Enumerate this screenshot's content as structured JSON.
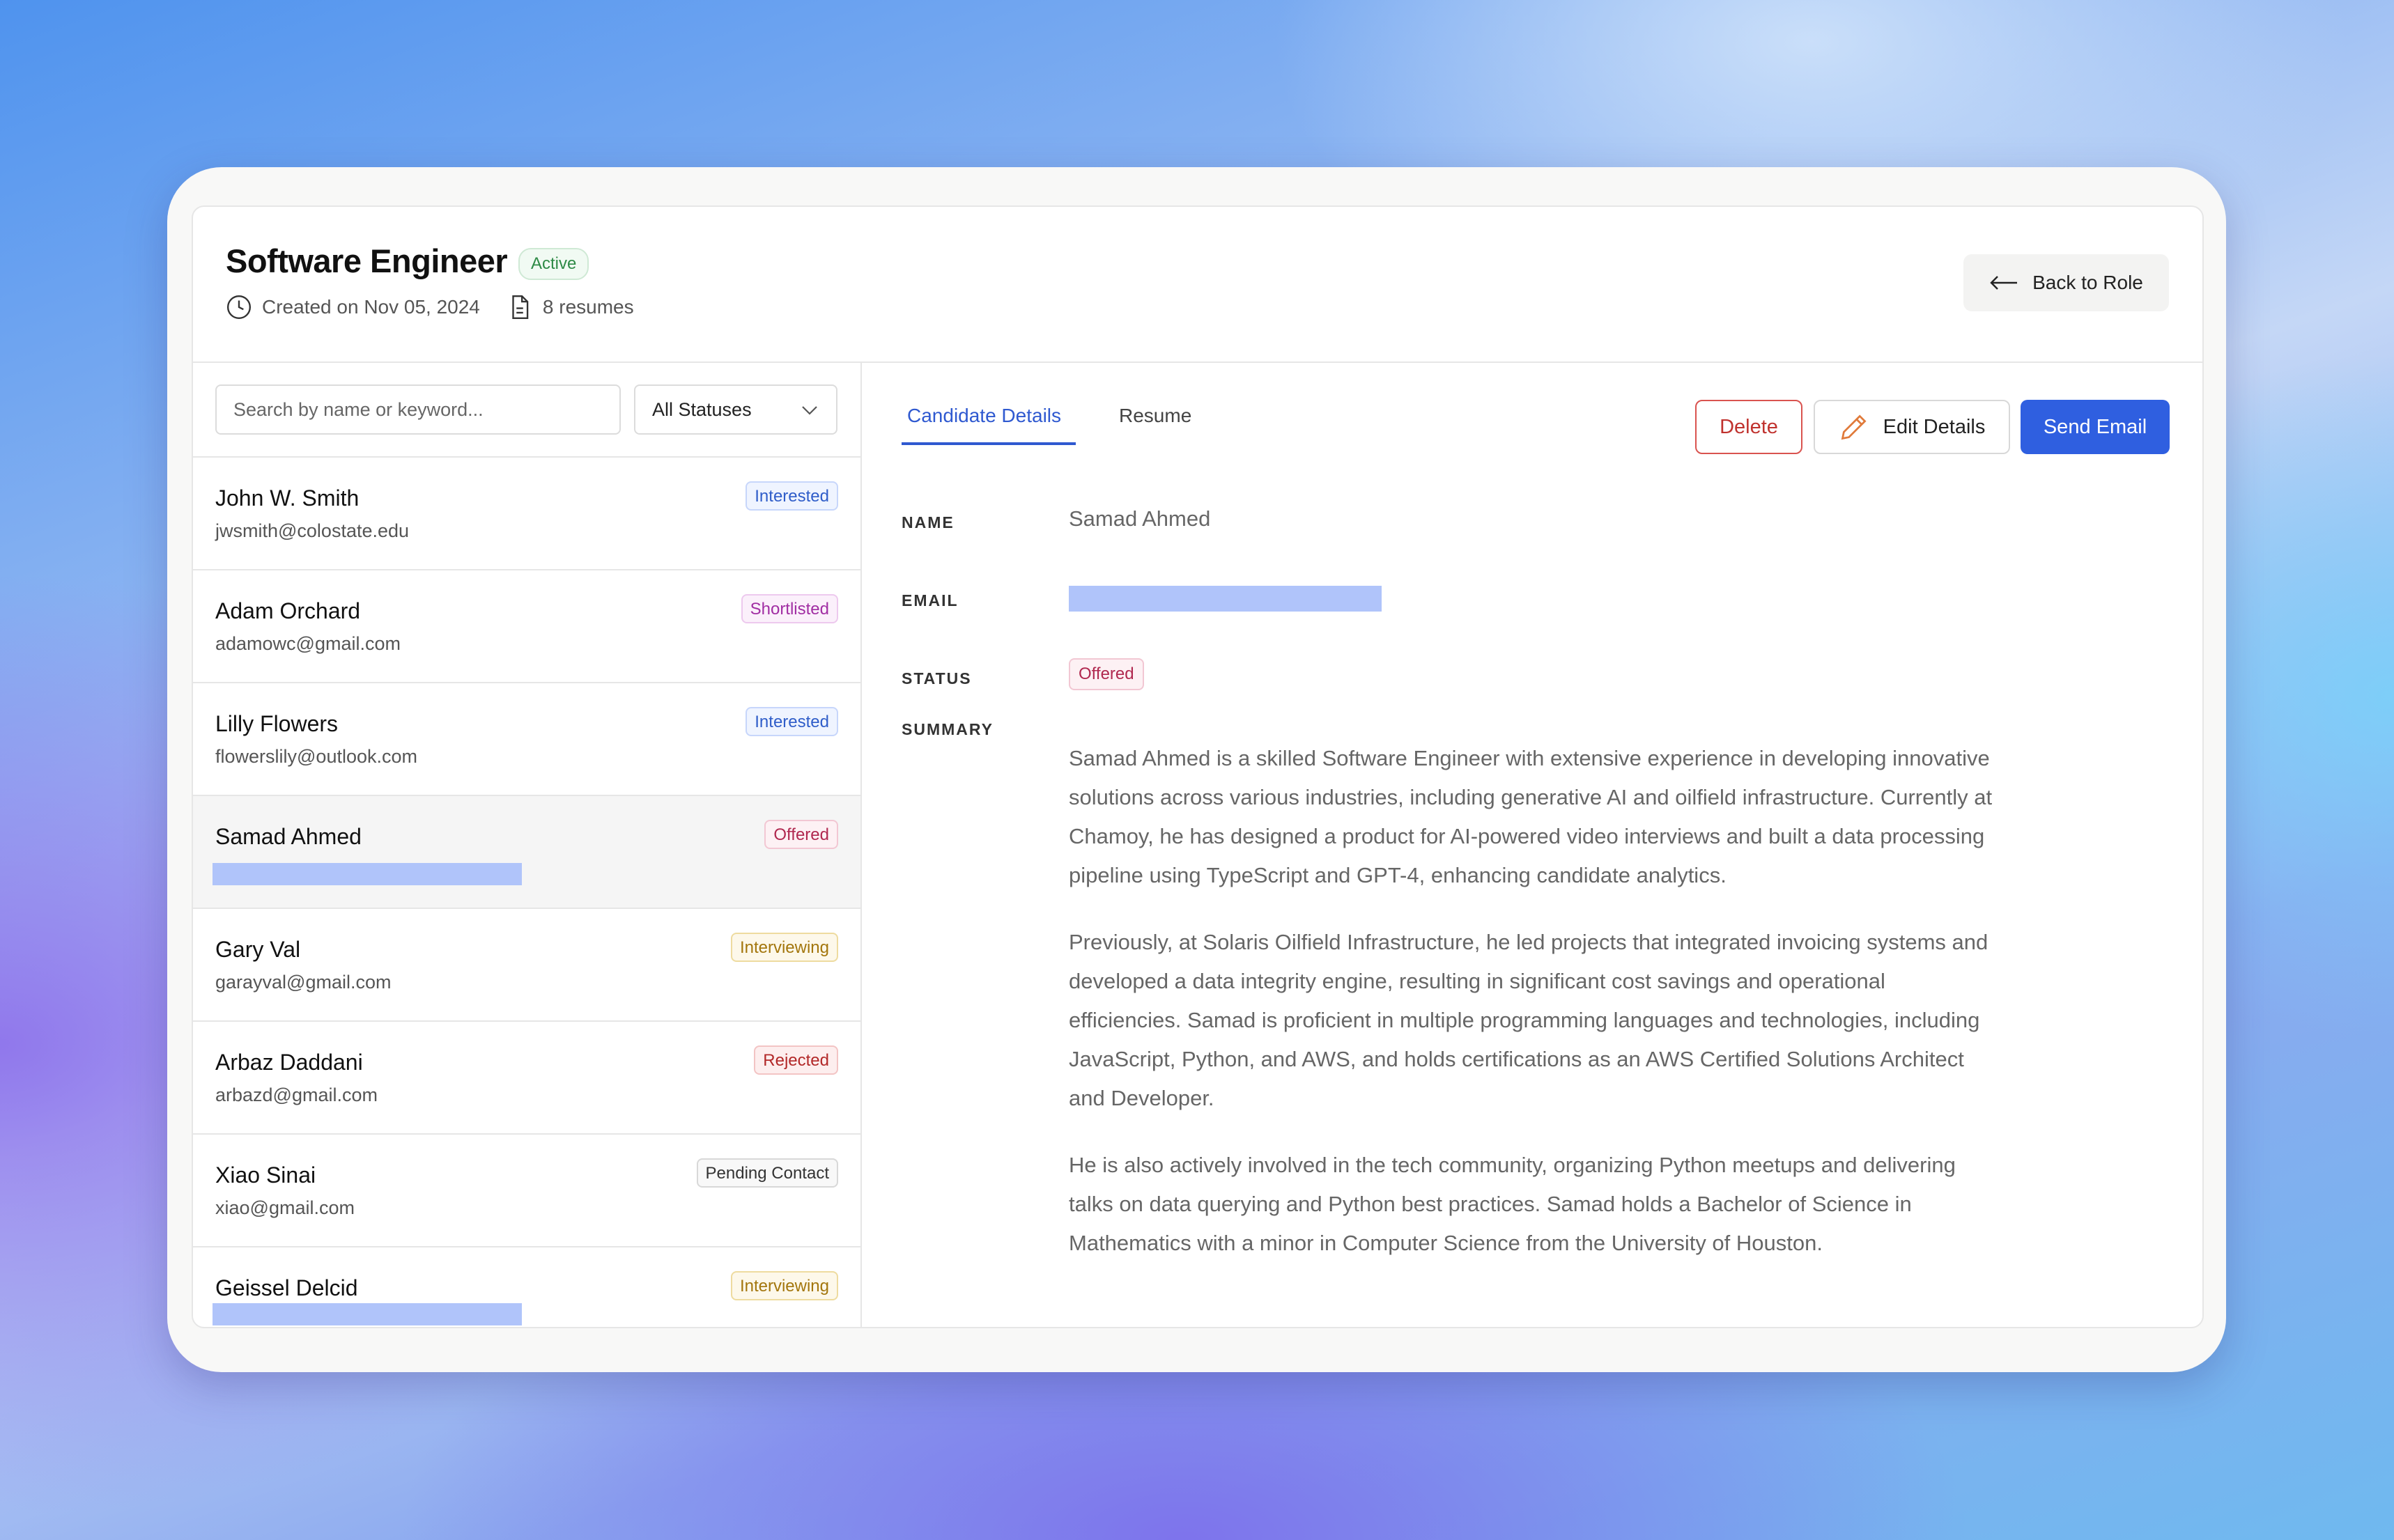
{
  "header": {
    "title": "Software Engineer",
    "status_badge": "Active",
    "created": "Created on Nov 05, 2024",
    "resumes": "8 resumes",
    "back_label": "Back to Role"
  },
  "filters": {
    "search_placeholder": "Search by name or keyword...",
    "status_filter": "All Statuses"
  },
  "candidates": [
    {
      "name": "John W. Smith",
      "email": "jwsmith@colostate.edu",
      "status": "Interested"
    },
    {
      "name": "Adam Orchard",
      "email": "adamowc@gmail.com",
      "status": "Shortlisted"
    },
    {
      "name": "Lilly Flowers",
      "email": "flowerslily@outlook.com",
      "status": "Interested"
    },
    {
      "name": "Samad Ahmed",
      "email": "",
      "status": "Offered"
    },
    {
      "name": "Gary Val",
      "email": "garayval@gmail.com",
      "status": "Interviewing"
    },
    {
      "name": "Arbaz Daddani",
      "email": "arbazd@gmail.com",
      "status": "Rejected"
    },
    {
      "name": "Xiao Sinai",
      "email": "xiao@gmail.com",
      "status": "Pending Contact"
    },
    {
      "name": "Geissel Delcid",
      "email": "",
      "status": "Interviewing"
    }
  ],
  "tabs": {
    "details": "Candidate Details",
    "resume": "Resume"
  },
  "actions": {
    "delete": "Delete",
    "edit": "Edit Details",
    "send": "Send Email"
  },
  "detail": {
    "name_label": "NAME",
    "name_value": "Samad Ahmed",
    "email_label": "EMAIL",
    "status_label": "STATUS",
    "status_value": "Offered",
    "summary_label": "SUMMARY",
    "summary": [
      "Samad Ahmed is a skilled Software Engineer with extensive experience in developing innovative solutions across various industries, including generative AI and oilfield infrastructure. Currently at Chamoy, he has designed a product for AI-powered video interviews and built a data processing pipeline using TypeScript and GPT-4, enhancing candidate analytics.",
      "Previously, at Solaris Oilfield Infrastructure, he led projects that integrated invoicing systems and developed a data integrity engine, resulting in significant cost savings and operational efficiencies. Samad is proficient in multiple programming languages and technologies, including JavaScript, Python, and AWS, and holds certifications as an AWS Certified Solutions Architect and Developer.",
      "He is also actively involved in the tech community, organizing Python meetups and delivering talks on data querying and Python best practices. Samad holds a Bachelor of Science in Mathematics with a minor in Computer Science from the University of Houston."
    ]
  },
  "colors": {
    "accent": "#2f5fe0",
    "delete": "#c0322e",
    "redaction": "#b0c4fa"
  }
}
